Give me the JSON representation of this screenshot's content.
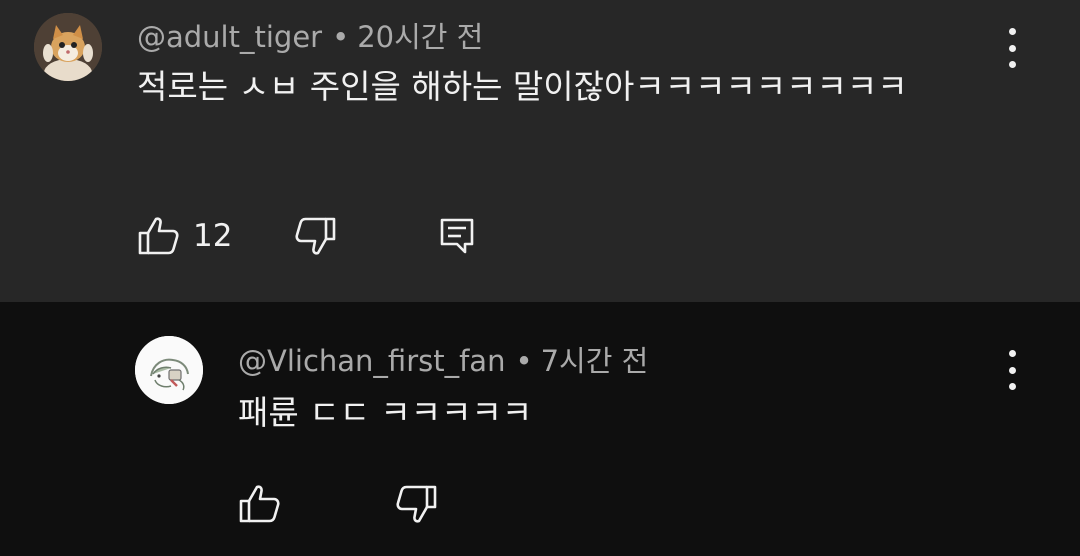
{
  "comments": [
    {
      "author": "@adult_tiger",
      "separator": "•",
      "time": "20시간 전",
      "text": "적로는 ㅅㅂ 주인을 해하는 말이잖아ㅋㅋㅋㅋㅋㅋㅋㅋㅋ",
      "like_count": "12",
      "avatar_icon": "cat-photo-avatar"
    },
    {
      "author": "@Vlichan_first_fan",
      "separator": "•",
      "time": "7시간 전",
      "text": "패륜 ㄷㄷ ㅋㅋㅋㅋㅋ",
      "avatar_icon": "sketch-character-avatar"
    }
  ],
  "colors": {
    "top_background": "#272727",
    "bottom_background": "#0f0f0f",
    "meta_text": "#aaaaaa",
    "body_text": "#f1f1f1"
  },
  "icons": {
    "like": "thumbs-up-icon",
    "dislike": "thumbs-down-icon",
    "reply": "reply-comment-icon",
    "menu": "kebab-menu-icon"
  }
}
